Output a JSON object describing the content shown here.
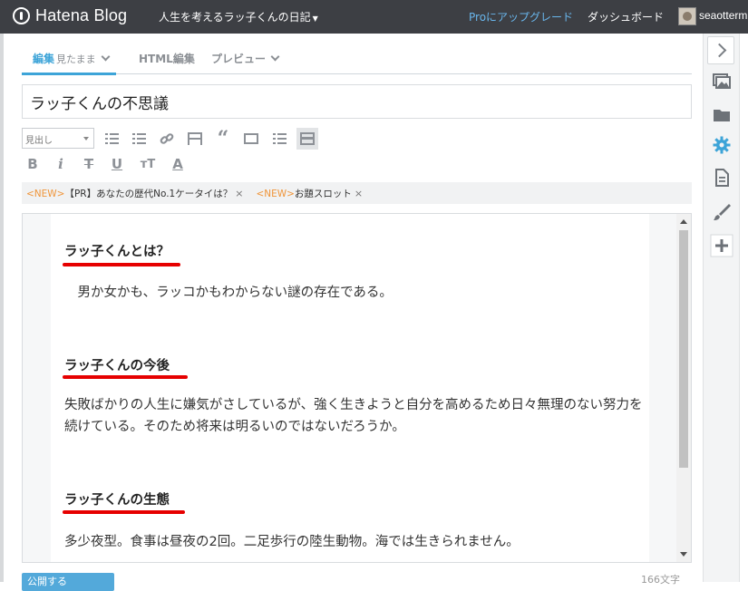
{
  "navbar": {
    "brand": "Hatena Blog",
    "blog_title": "人生を考えるラッ子くんの日記",
    "blog_title_caret": "▼",
    "pro_link": "Proにアップグレード",
    "dashboard_link": "ダッシュボード",
    "username": "seaotterm"
  },
  "tabs": {
    "edit": "編集",
    "edit_mode": "見たまま",
    "html_edit": "HTML編集",
    "preview": "プレビュー"
  },
  "title_field": {
    "value": "ラッ子くんの不思議"
  },
  "toolbar": {
    "heading_select": "見出し",
    "bold": "B",
    "italic": "i",
    "strike": "T",
    "underline": "U",
    "font_size": "тT",
    "text_color": "A"
  },
  "pr_bar": {
    "items": [
      {
        "new": "<NEW>",
        "text": "【PR】あなたの歴代No.1ケータイは？",
        "close": "×"
      },
      {
        "new": "<NEW>",
        "text": "お題スロット",
        "close": "×"
      }
    ]
  },
  "article": {
    "sections": [
      {
        "heading": "ラッ子くんとは？",
        "body": "　男か女かも、ラッコかもわからない謎の存在である。"
      },
      {
        "heading": "ラッ子くんの今後",
        "body": "失敗ばかりの人生に嫌気がさしているが、強く生きようと自分を高めるため日々無理のない努力を続けている。そのため将来は明るいのではないだろうか。"
      },
      {
        "heading": "ラッ子くんの生態",
        "body": "多少夜型。食事は昼夜の2回。二足歩行の陸生動物。海では生きられません。"
      }
    ]
  },
  "footer": {
    "publish": "公開する",
    "char_count": "166文字"
  },
  "colors": {
    "navbar": "#3d3f44",
    "accent": "#3da4d8",
    "pro": "#69b6ec",
    "new_badge": "#f0953a",
    "annotation_underline": "#e60000"
  },
  "sidebar_icons": [
    "chevron-right-icon",
    "image-icon",
    "folder-icon",
    "gear-icon",
    "document-icon",
    "brush-icon",
    "plus-icon"
  ]
}
